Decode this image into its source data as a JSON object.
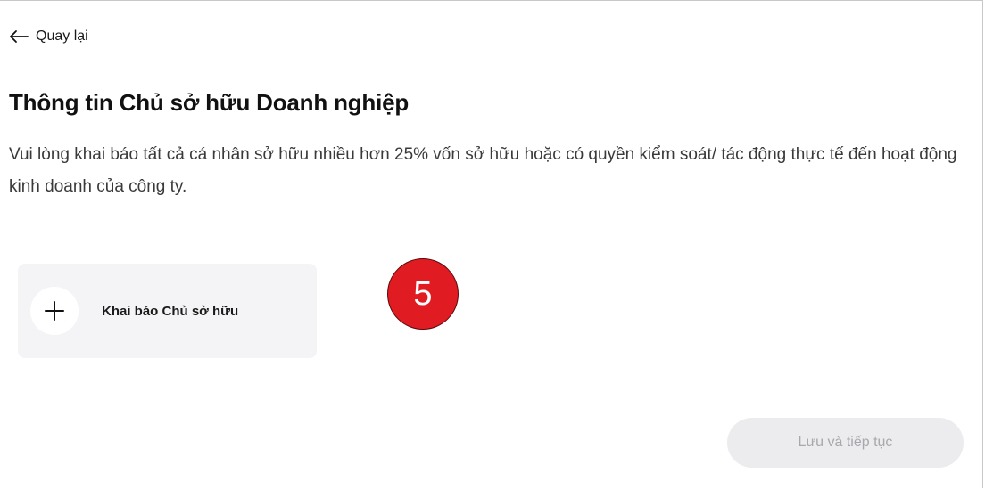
{
  "nav": {
    "back_label": "Quay lại",
    "back_icon": "arrow-left-icon"
  },
  "page": {
    "title": "Thông tin Chủ sở hữu Doanh nghiệp",
    "description": "Vui lòng khai báo tất cả cá nhân sở hữu nhiều hơn 25% vốn sở hữu hoặc có quyền kiểm soát/ tác động thực tế đến hoạt động kinh doanh của công ty."
  },
  "add_owner": {
    "label": "Khai báo Chủ sở hữu",
    "icon": "plus-icon"
  },
  "step_badge": {
    "number": "5",
    "color": "#e11b22"
  },
  "actions": {
    "save_continue_label": "Lưu và tiếp tục",
    "save_continue_disabled": true
  }
}
